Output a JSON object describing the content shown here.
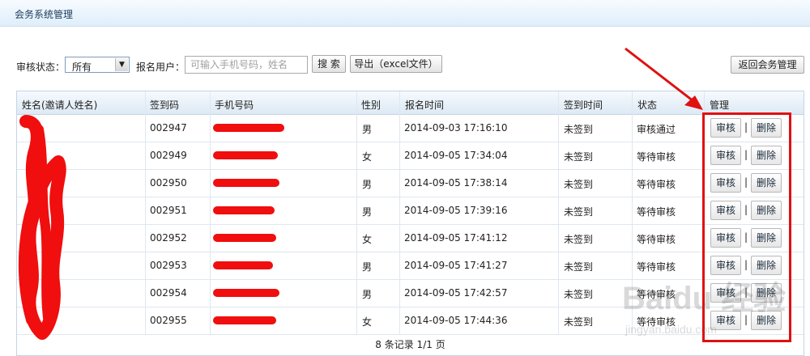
{
  "header": {
    "title": "会务系统管理"
  },
  "toolbar": {
    "status_label": "审核状态：",
    "status_select_value": "所有",
    "user_label": "报名用户：",
    "search_placeholder": "可输入手机号码，姓名",
    "search_button": "搜 索",
    "export_button": "导出（excel文件）",
    "back_button": "返回会务管理"
  },
  "table": {
    "headers": [
      "姓名(邀请人姓名)",
      "签到码",
      "手机号码",
      "性别",
      "报名时间",
      "签到时间",
      "状态",
      "管理"
    ],
    "rows": [
      {
        "code": "002947",
        "gender": "男",
        "time": "2014-09-03 17:16:10",
        "checkin": "未签到",
        "status": "审核通过"
      },
      {
        "code": "002949",
        "gender": "女",
        "time": "2014-09-05 17:34:04",
        "checkin": "未签到",
        "status": "等待审核"
      },
      {
        "code": "002950",
        "gender": "男",
        "time": "2014-09-05 17:38:14",
        "checkin": "未签到",
        "status": "等待审核"
      },
      {
        "code": "002951",
        "gender": "男",
        "time": "2014-09-05 17:39:16",
        "checkin": "未签到",
        "status": "等待审核"
      },
      {
        "code": "002952",
        "gender": "女",
        "time": "2014-09-05 17:41:12",
        "checkin": "未签到",
        "status": "等待审核"
      },
      {
        "code": "002953",
        "gender": "男",
        "time": "2014-09-05 17:41:27",
        "checkin": "未签到",
        "status": "等待审核"
      },
      {
        "code": "002954",
        "gender": "男",
        "time": "2014-09-05 17:42:57",
        "checkin": "未签到",
        "status": "等待审核"
      },
      {
        "code": "002955",
        "gender": "女",
        "time": "2014-09-05 17:44:36",
        "checkin": "未签到",
        "status": "等待审核"
      }
    ],
    "action_review": "审核",
    "action_delete": "删除",
    "action_sep": "|",
    "footer": "8 条记录 1/1 页"
  },
  "annotation": {
    "color": "#e01010"
  },
  "watermark": {
    "text": "Baidu 经验",
    "sub": "jingyan.baidu.com"
  }
}
